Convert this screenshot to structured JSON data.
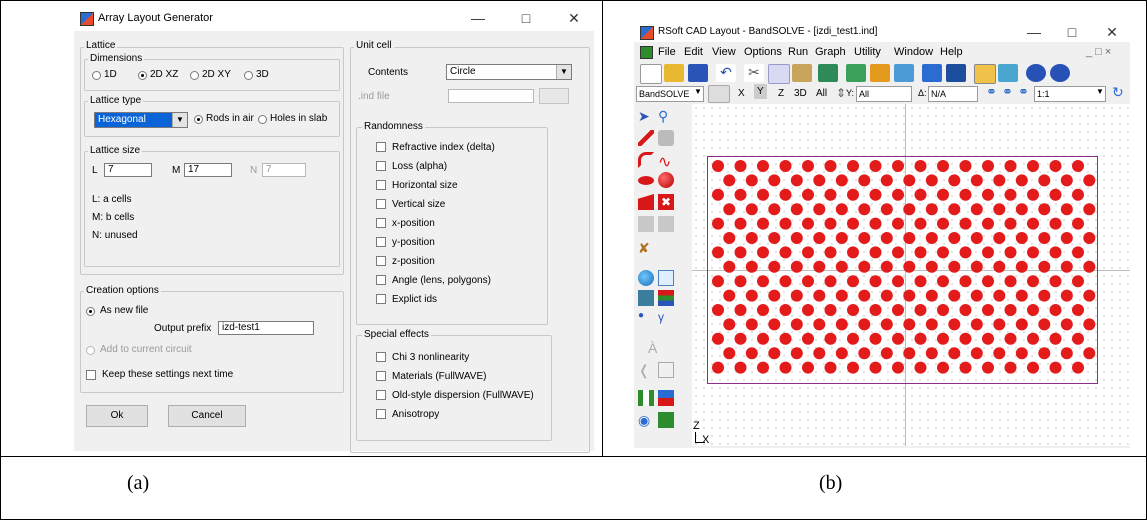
{
  "captions": {
    "left": "(a)",
    "right": "(b)"
  },
  "dialog": {
    "title": "Array Layout Generator",
    "lattice": {
      "label": "Lattice",
      "dimensions_label": "Dimensions",
      "dimensions": [
        "1D",
        "2D XZ",
        "2D XY",
        "3D"
      ],
      "dimensions_selected": "2D XZ",
      "lattice_type_label": "Lattice type",
      "lattice_type_value": "Hexagonal",
      "rods_in_air": "Rods in air",
      "holes_in_slab": "Holes in slab",
      "size_label": "Lattice size",
      "l_label": "L",
      "l_value": "7",
      "m_label": "M",
      "m_value": "17",
      "n_label": "N",
      "n_value": "7",
      "info_l": "L: a cells",
      "info_m": "M: b cells",
      "info_n": "N: unused"
    },
    "creation": {
      "label": "Creation options",
      "as_new_file": "As new file",
      "output_prefix_label": "Output prefix",
      "output_prefix_value": "izd-test1",
      "add_to_circuit": "Add to current circuit",
      "keep_settings": "Keep these settings next time"
    },
    "ok": "Ok",
    "cancel": "Cancel",
    "unit_cell": {
      "label": "Unit cell",
      "contents_label": "Contents",
      "contents_value": "Circle",
      "ind_file_label": ".ind file"
    },
    "randomness": {
      "label": "Randomness",
      "items": [
        "Refractive index (delta)",
        "Loss (alpha)",
        "Horizontal size",
        "Vertical size",
        "x-position",
        "y-position",
        "z-position",
        "Angle (lens, polygons)",
        "Explict ids"
      ]
    },
    "special": {
      "label": "Special effects",
      "items": [
        "Chi 3 nonlinearity",
        "Materials (FullWAVE)",
        "Old-style dispersion (FullWAVE)",
        "Anisotropy"
      ]
    }
  },
  "cad": {
    "title": "RSoft CAD Layout - BandSOLVE - [izdi_test1.ind]",
    "menu": [
      "File",
      "Edit",
      "View",
      "Options",
      "Run",
      "Graph",
      "Utility",
      "Window",
      "Help"
    ],
    "module_select": "BandSOLVE",
    "axis_buttons": [
      "X",
      "Y",
      "Z",
      "3D",
      "All"
    ],
    "y_field": "All",
    "delta_field": "N/A",
    "zoom_value": "1:1",
    "axis_z": "Z",
    "axis_x": "X",
    "lattice_rows": 15,
    "lattice_cols": 17,
    "rod_color": "#e31b1b",
    "frame_color": "#8e2c8e"
  }
}
